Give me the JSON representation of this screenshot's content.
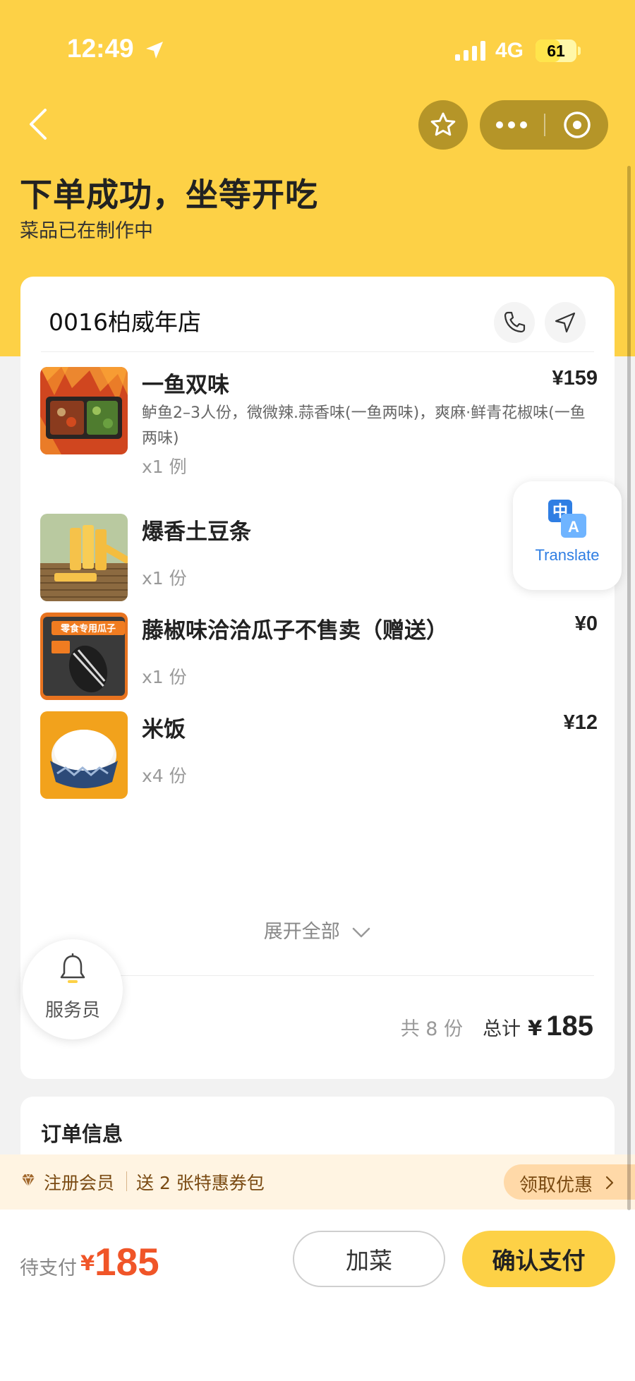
{
  "status_bar": {
    "time": "12:49",
    "network": "4G",
    "battery": "61",
    "battery_fraction": 0.61
  },
  "header": {
    "title": "下单成功，坐等开吃",
    "subtitle": "菜品已在制作中"
  },
  "store": {
    "name": "0016柏威年店"
  },
  "items": [
    {
      "name": "一鱼双味",
      "price": "¥159",
      "desc": "鲈鱼2–3人份，微微辣.蒜香味(一鱼两味)，爽麻·鲜青花椒味(一鱼两味)",
      "qty": "x1 例",
      "thumb": "grilled-fish-photo"
    },
    {
      "name": "爆香土豆条",
      "price": "",
      "desc": "",
      "qty": "x1 份",
      "thumb": "potato-sticks-photo"
    },
    {
      "name": "藤椒味洽洽瓜子不售卖（赠送）",
      "price": "¥0",
      "desc": "",
      "qty": "x1 份",
      "thumb": "sunflower-seeds-pack-photo",
      "pack_text": "零食专用瓜子"
    },
    {
      "name": "米饭",
      "price": "¥12",
      "desc": "",
      "qty": "x4 份",
      "thumb": "rice-bowl-photo"
    }
  ],
  "expand_label": "展开全部",
  "summary": {
    "count": "共 8 份",
    "total_label": "总计",
    "currency": "¥",
    "total": "185"
  },
  "translate": {
    "label": "Translate",
    "icon": "translate-icon"
  },
  "waiter": {
    "label": "服务员",
    "icon": "bell-icon"
  },
  "order_info": {
    "title": "订单信息"
  },
  "member_banner": {
    "text1": "注册会员",
    "text2": "送 2 张特惠券包",
    "claim": "领取优惠"
  },
  "bottom": {
    "pay_label": "待支付",
    "currency": "¥",
    "amount": "185",
    "add_button": "加菜",
    "pay_button": "确认支付"
  },
  "colors": {
    "brand_yellow": "#fdd146",
    "price_red": "#f05528",
    "translate_blue": "#2f7ee3"
  }
}
